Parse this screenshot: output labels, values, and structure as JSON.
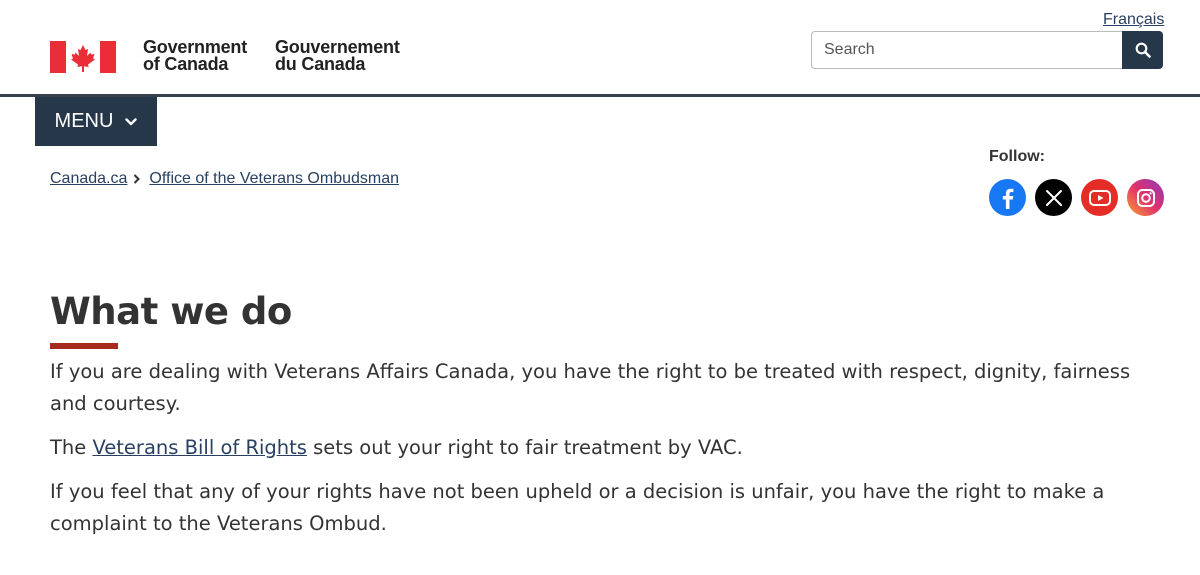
{
  "header": {
    "language_link": "Français",
    "signature_en": [
      "Government",
      "of Canada"
    ],
    "signature_fr": [
      "Gouvernement",
      "du Canada"
    ],
    "search": {
      "placeholder": "Search",
      "button_icon": "search-icon"
    },
    "menu_label": "MENU"
  },
  "breadcrumb": [
    "Canada.ca",
    "Office of the Veterans Ombudsman"
  ],
  "follow": {
    "label": "Follow:",
    "networks": [
      "facebook-icon",
      "x-icon",
      "youtube-icon",
      "instagram-icon"
    ]
  },
  "main": {
    "title": "What we do",
    "paragraphs": {
      "p1": "If you are dealing with Veterans Affairs Canada, you have the right to be treated with respect, dignity, fairness and courtesy.",
      "p2_before": "The ",
      "p2_link": "Veterans Bill of Rights",
      "p2_after": " sets out your right to fair treatment by VAC.",
      "p3": "If you feel that any of your rights have not been upheld or a decision is unfair, you have the right to make a complaint to the Veterans Ombud."
    }
  },
  "colors": {
    "flag_red": "#eb2d37",
    "nav_dark": "#26374a",
    "link": "#284162",
    "title_accent": "#a62a1e"
  }
}
